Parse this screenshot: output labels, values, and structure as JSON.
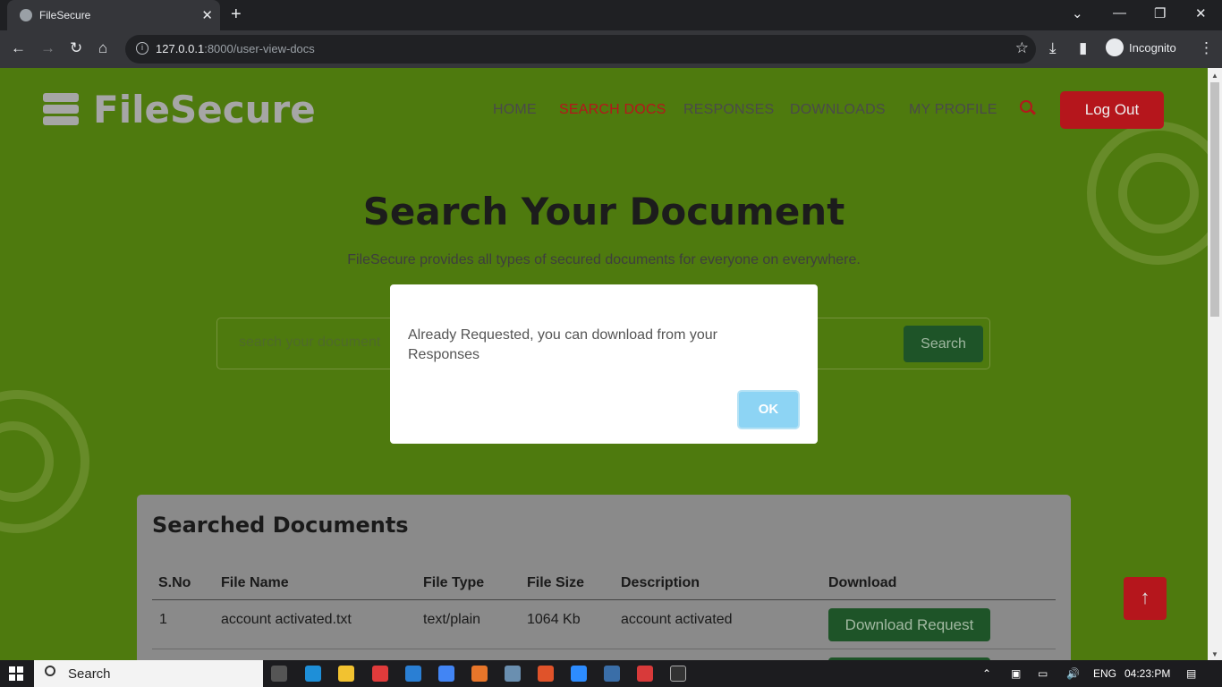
{
  "browser": {
    "tab_title": "FileSecure",
    "url_host": "127.0.0.1",
    "url_rest": ":8000/user-view-docs",
    "profile_label": "Incognito"
  },
  "site": {
    "brand": "FileSecure",
    "nav": [
      "HOME",
      "SEARCH DOCS",
      "RESPONSES",
      "DOWNLOADS",
      "MY PROFILE"
    ],
    "active_nav": "SEARCH DOCS",
    "logout_label": "Log Out"
  },
  "hero": {
    "title": "Search Your Document",
    "subtitle": "FileSecure provides all types of secured documents for everyone on everywhere.",
    "search_placeholder": "search your document",
    "search_button": "Search"
  },
  "results": {
    "heading": "Searched Documents",
    "columns": [
      "S.No",
      "File Name",
      "File Type",
      "File Size",
      "Description",
      "Download"
    ],
    "rows": [
      {
        "sno": "1",
        "file_name": "account activated.txt",
        "file_type": "text/plain",
        "file_size": "1064 Kb",
        "description": "account activated",
        "action": "Download Request"
      }
    ]
  },
  "dialog": {
    "message": "Already Requested, you can download from your Responses",
    "ok_label": "OK"
  },
  "taskbar": {
    "search_label": "Search",
    "language": "ENG",
    "time": "04:23:PM"
  },
  "colors": {
    "page_bg": "#4e7a0e",
    "accent_red": "#b5161c",
    "button_green": "#1e5428",
    "ok_blue": "#8dd4f4"
  }
}
